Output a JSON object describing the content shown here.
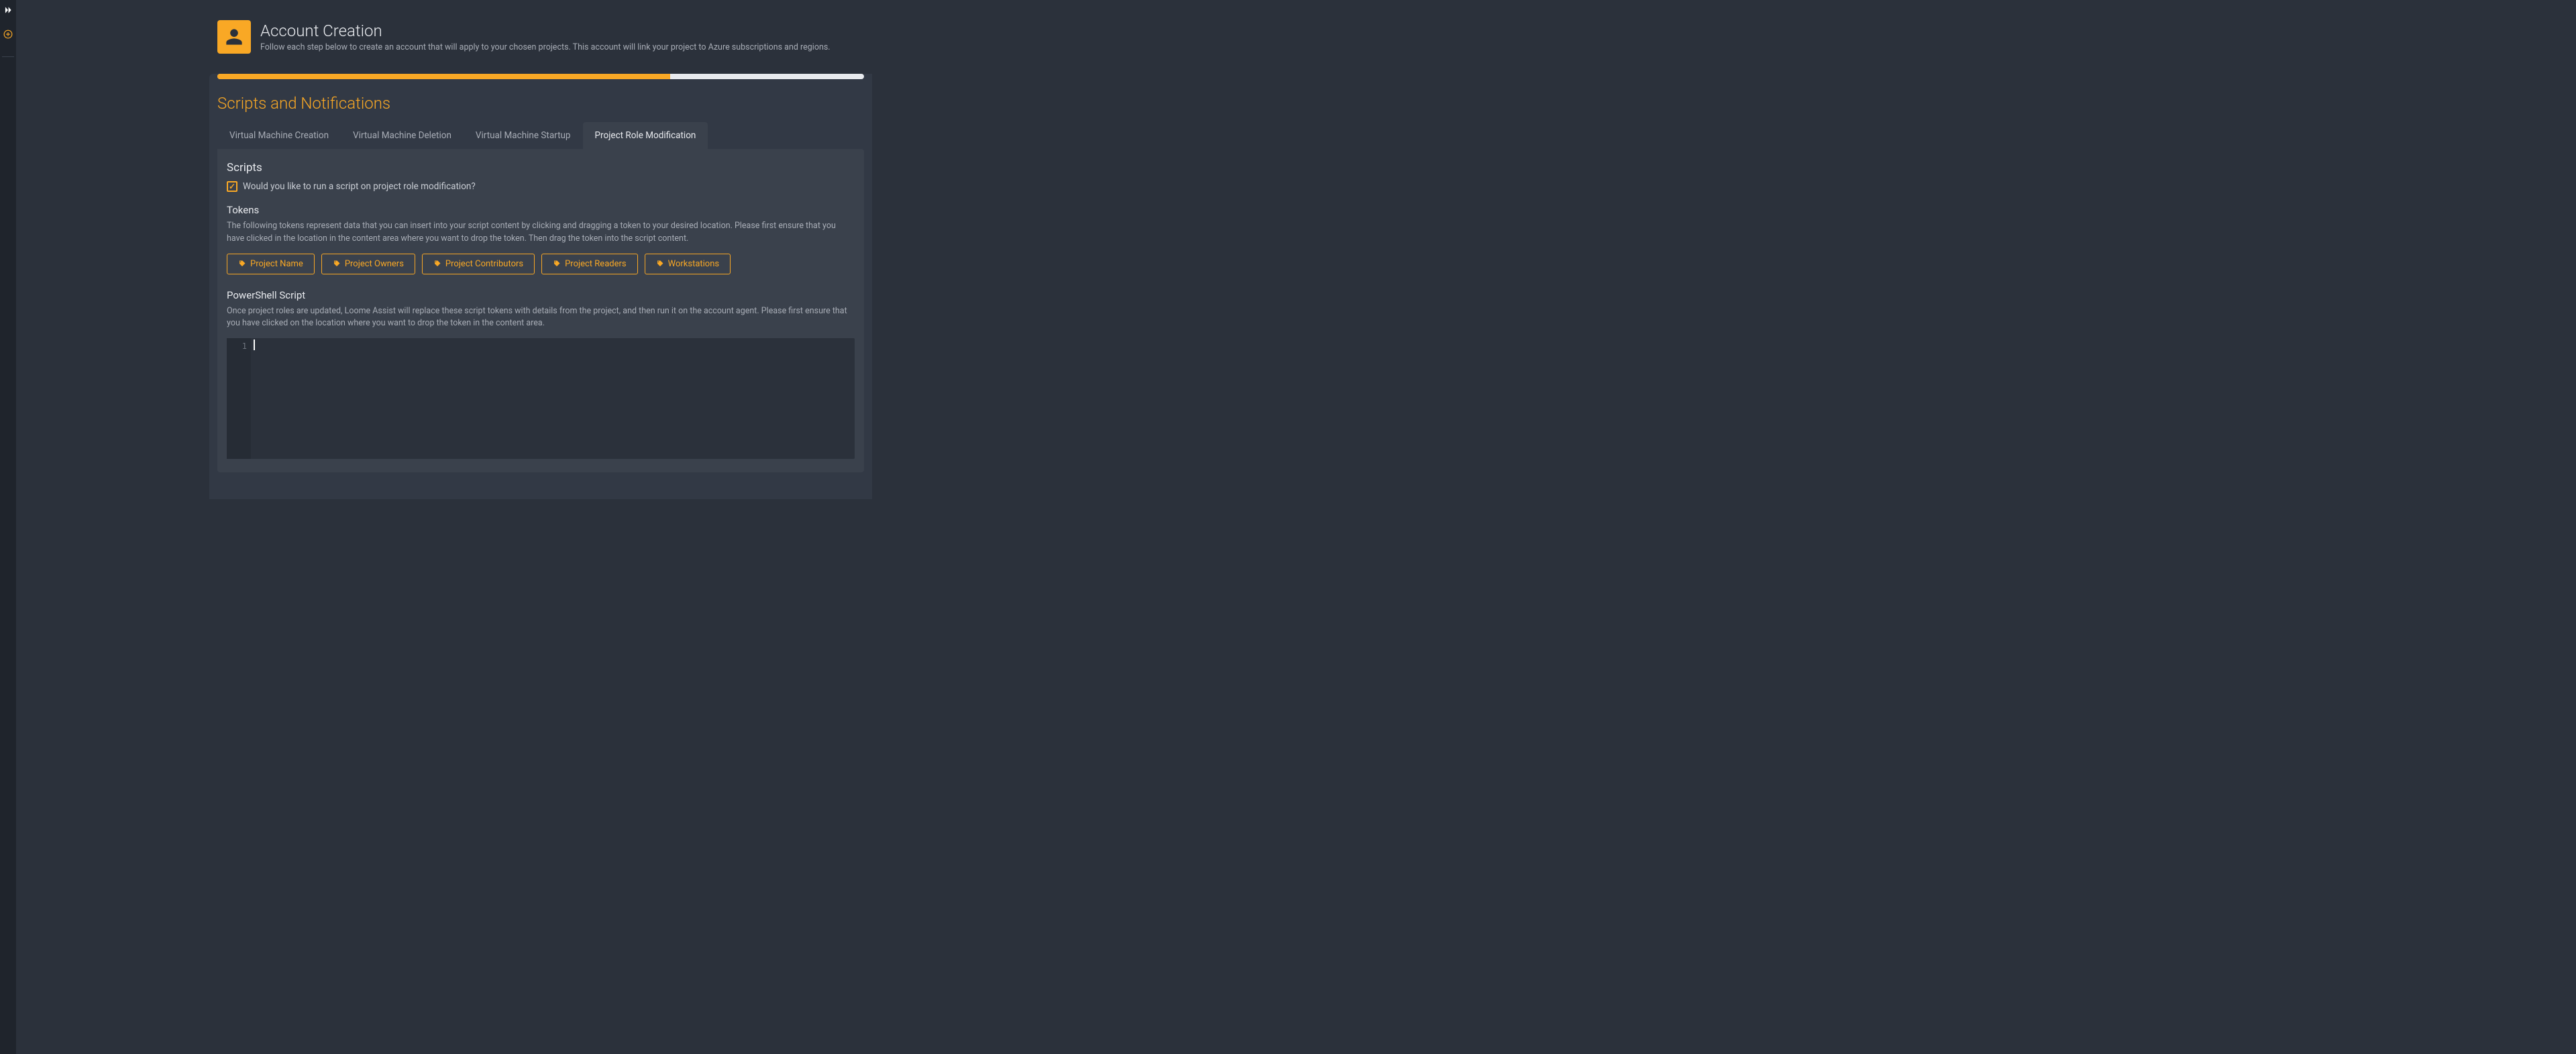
{
  "header": {
    "title": "Account Creation",
    "subtitle": "Follow each step below to create an account that will apply to your chosen projects. This account will link your project to Azure subscriptions and regions."
  },
  "progress": {
    "percent": 70
  },
  "section": {
    "title": "Scripts and Notifications"
  },
  "tabs": [
    {
      "label": "Virtual Machine Creation",
      "active": false
    },
    {
      "label": "Virtual Machine Deletion",
      "active": false
    },
    {
      "label": "Virtual Machine Startup",
      "active": false
    },
    {
      "label": "Project Role Modification",
      "active": true
    }
  ],
  "scripts": {
    "heading": "Scripts",
    "checkbox_label": "Would you like to run a script on project role modification?",
    "checked": true
  },
  "tokens": {
    "heading": "Tokens",
    "description": "The following tokens represent data that you can insert into your script content by clicking and dragging a token to your desired location. Please first ensure that you have clicked in the location in the content area where you want to drop the token. Then drag the token into the script content.",
    "items": [
      "Project Name",
      "Project Owners",
      "Project Contributors",
      "Project Readers",
      "Workstations"
    ]
  },
  "powershell": {
    "heading": "PowerShell Script",
    "description": "Once project roles are updated, Loome Assist will replace these script tokens with details from the project, and then run it on the account agent. Please first ensure that you have clicked on the location where you want to drop the token in the content area."
  },
  "editor": {
    "line_number": "1",
    "content": ""
  }
}
